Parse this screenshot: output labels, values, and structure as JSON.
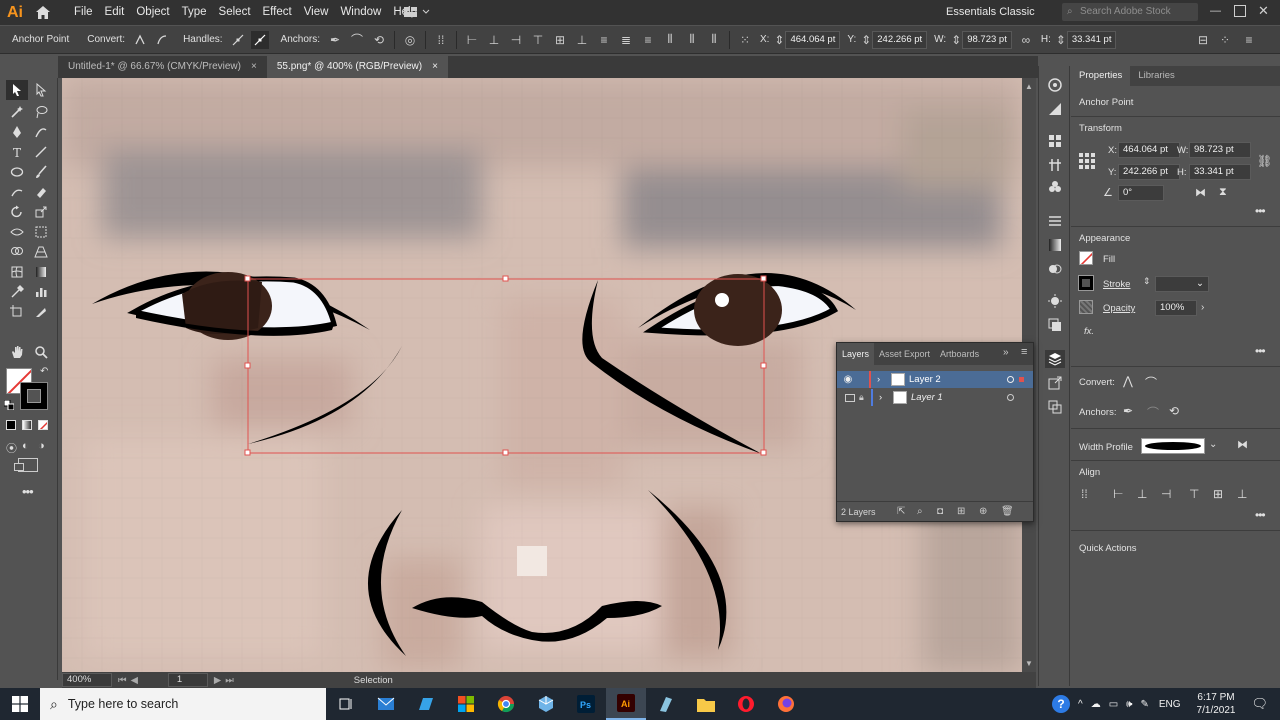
{
  "app": {
    "logo": "Ai",
    "menus": [
      "File",
      "Edit",
      "Object",
      "Type",
      "Select",
      "Effect",
      "View",
      "Window",
      "Help"
    ],
    "workspace": "Essentials Classic",
    "search_placeholder": "Search Adobe Stock"
  },
  "controlbar": {
    "anchor_label": "Anchor Point",
    "convert_label": "Convert:",
    "handles_label": "Handles:",
    "anchors_label": "Anchors:",
    "x_label": "X:",
    "x_value": "464.064 pt",
    "y_label": "Y:",
    "y_value": "242.266 pt",
    "w_label": "W:",
    "w_value": "98.723 pt",
    "h_label": "H:",
    "h_value": "33.341 pt"
  },
  "tabs": [
    {
      "label": "Untitled-1* @ 66.67% (CMYK/Preview)",
      "close": "×"
    },
    {
      "label": "55.png* @ 400% (RGB/Preview)",
      "close": "×"
    }
  ],
  "status": {
    "zoom": "400%",
    "page": "1",
    "tool": "Selection"
  },
  "properties": {
    "tabs": [
      "Properties",
      "Libraries"
    ],
    "selection_type": "Anchor Point",
    "transform_title": "Transform",
    "x_label": "X:",
    "x_value": "464.064 pt",
    "y_label": "Y:",
    "y_value": "242.266 pt",
    "w_label": "W:",
    "w_value": "98.723 pt",
    "h_label": "H:",
    "h_value": "33.341 pt",
    "rotate_value": "0°",
    "appearance_title": "Appearance",
    "fill_label": "Fill",
    "stroke_label": "Stroke",
    "opacity_label": "Opacity",
    "opacity_value": "100%",
    "fx_label": "fx.",
    "convert_label": "Convert:",
    "anchors_label": "Anchors:",
    "width_profile_label": "Width Profile",
    "align_title": "Align",
    "quick_actions_title": "Quick Actions"
  },
  "layers": {
    "tabs": [
      "Layers",
      "Asset Export",
      "Artboards"
    ],
    "rows": [
      {
        "name": "Layer 2",
        "color": "#e0524f"
      },
      {
        "name": "Layer 1",
        "color": "#4f7ce0"
      }
    ],
    "count": "2 Layers"
  },
  "taskbar": {
    "search_placeholder": "Type here to search",
    "language": "ENG",
    "time": "6:17 PM",
    "date": "7/1/2021"
  }
}
